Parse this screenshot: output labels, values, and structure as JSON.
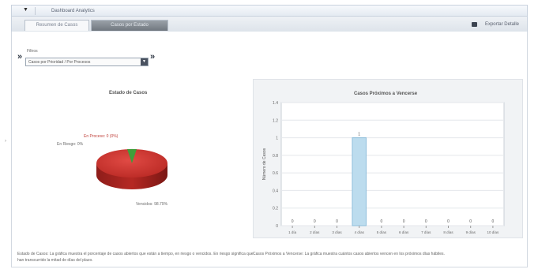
{
  "window": {
    "title": "Dashboard Analytics",
    "menu_glyph": "▼"
  },
  "tabs": [
    {
      "label": "Resumen de Casos"
    },
    {
      "label": "Casos por Estado"
    }
  ],
  "toolbar": {
    "export_label": "Exportar Detalle",
    "export_icon": "export-icon"
  },
  "filter": {
    "label": "Filtros",
    "selected": "Casos por Prioridad / Por Procesos",
    "dropdown_glyph": "▼",
    "prev_glyph": "»",
    "next_glyph": "»"
  },
  "pie_chart": {
    "title": "Estado de Casos",
    "labels": {
      "a": "En Proceso: 0 (0%)",
      "b": "En Riesgo: 0%",
      "c": "Vencidos: 98.79%"
    },
    "description": "Estado de Casos: La gráfica muestra el porcentaje de casos abiertos que están a tiempo, en riesgo o vencidos. En riesgo significa que han transcurrido la mitad de días del plazo."
  },
  "chart_data": {
    "type": "bar",
    "title": "Casos Próximos a Vencerse",
    "ylabel": "Número de Casos",
    "xlabel": "",
    "ylim": [
      0,
      1.4
    ],
    "y_ticks": [
      "0",
      "0.2",
      "0.4",
      "0.6",
      "0.8",
      "1",
      "1.2",
      "1.4"
    ],
    "categories": [
      "1 día",
      "2 días",
      "3 días",
      "4 días",
      "5 días",
      "6 días",
      "7 días",
      "8 días",
      "9 días",
      "10 días"
    ],
    "values": [
      0,
      0,
      0,
      1,
      0,
      0,
      0,
      0,
      0,
      0
    ],
    "data_labels": [
      "0",
      "0",
      "0",
      "1",
      "0",
      "0",
      "0",
      "0",
      "0",
      "0"
    ],
    "bar_color": "#bcdcee",
    "grid": true,
    "description": "Casos Próximos a Vencerse: La gráfica muestra cuántos casos abiertos vencen en los próximos días hábiles."
  },
  "colors": {
    "pie_main": "#c22e2a",
    "pie_slice": "#3f9e3a",
    "accent_tab": "#80878f"
  }
}
